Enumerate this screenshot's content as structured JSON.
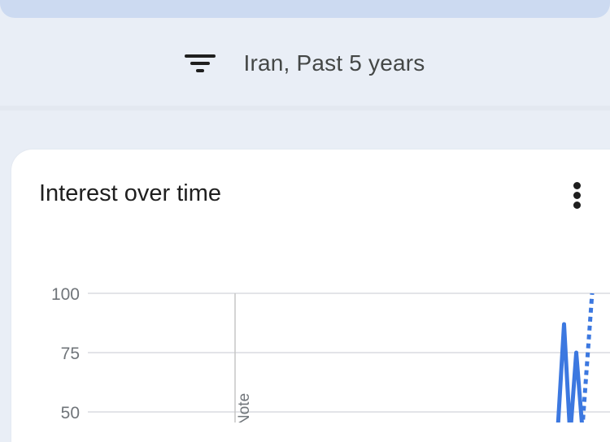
{
  "filter": {
    "icon": "filter-list-icon",
    "label": "Iran, Past 5 years"
  },
  "card": {
    "title": "Interest over time",
    "menu_icon": "more-vert-icon"
  },
  "colors": {
    "series": "#3c78e0",
    "grid": "#dadce0",
    "annotation_line": "#c6c6c6"
  },
  "chart_data": {
    "type": "line",
    "y_ticks": [
      100,
      75,
      50
    ],
    "ylim": [
      0,
      100
    ],
    "annotation": {
      "label_fragment": "Note",
      "style": "vertical-line"
    },
    "series": [
      {
        "style": "solid",
        "points": [
          {
            "x": 0.0,
            "y": 44
          },
          {
            "x": 0.25,
            "y": 87
          },
          {
            "x": 0.5,
            "y": 40
          },
          {
            "x": 0.75,
            "y": 75
          },
          {
            "x": 1.0,
            "y": 43
          }
        ]
      },
      {
        "style": "dotted",
        "points": [
          {
            "x": 1.0,
            "y": 43
          },
          {
            "x": 1.4,
            "y": 100
          }
        ]
      }
    ]
  }
}
